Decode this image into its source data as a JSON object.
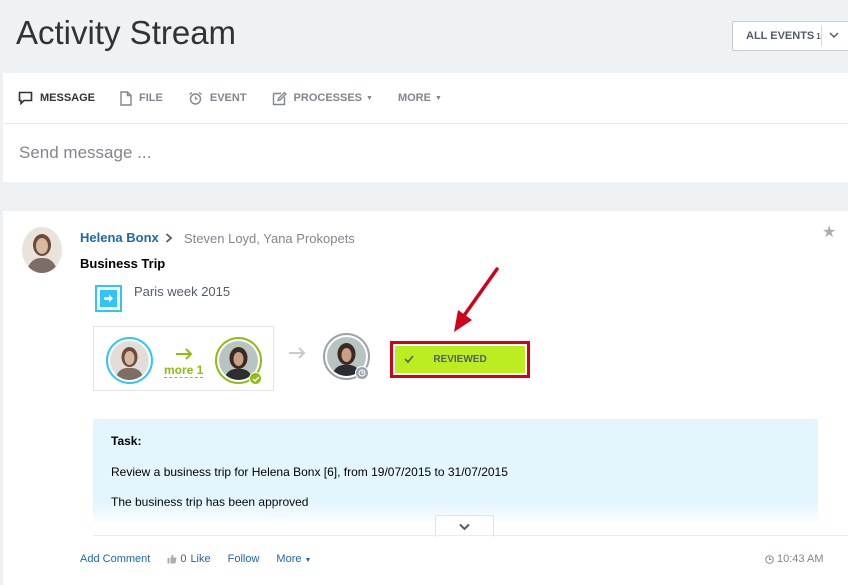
{
  "page_title": "Activity Stream",
  "events_filter": {
    "label": "ALL EVENTS",
    "count": "1"
  },
  "composer": {
    "tabs": [
      {
        "label": "MESSAGE",
        "icon": "message-icon"
      },
      {
        "label": "FILE",
        "icon": "file-icon"
      },
      {
        "label": "EVENT",
        "icon": "alarm-clock-icon"
      },
      {
        "label": "PROCESSES",
        "icon": "edit-icon"
      },
      {
        "label": "MORE",
        "icon": ""
      }
    ],
    "placeholder": "Send message ..."
  },
  "post": {
    "author": "Helena Bonx",
    "recipients": "Steven Loyd, Yana Prokopets",
    "title": "Business Trip",
    "trip_name": "Paris week 2015",
    "workflow": {
      "more_label": "more 1",
      "status": "REVIEWED"
    },
    "task": {
      "label": "Task:",
      "text": "Review a business trip for Helena Bonx [6], from 19/07/2015 to 31/07/2015",
      "status_text": "The business trip has been approved"
    },
    "actions": {
      "comment": "Add Comment",
      "like_count": "0",
      "like": "Like",
      "follow": "Follow",
      "more": "More"
    },
    "time": "10:43 AM"
  },
  "colors": {
    "accent_blue": "#2067b0",
    "status_green": "#bbed21",
    "highlight_red": "#d0021b",
    "task_bg": "#e4f6fd"
  }
}
